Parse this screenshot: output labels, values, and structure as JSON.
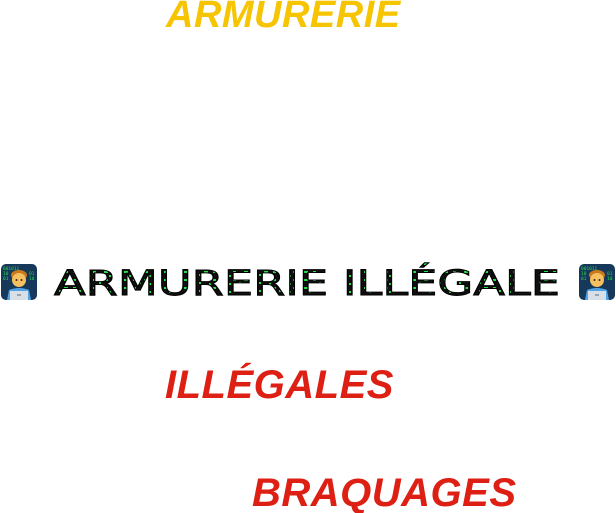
{
  "headings": {
    "top": "ARMURERIE",
    "banner": "ARMURERIE ILLÉGALE",
    "middle": "ILLÉGALES",
    "bottom": "BRAQUAGES"
  },
  "icons": {
    "banner_left": "technologist-emoji-icon",
    "banner_right": "technologist-emoji-icon"
  },
  "colors": {
    "yellow": "#f6c400",
    "red": "#dd1f14",
    "banner_text": "#101010",
    "banner_code": "#22e04a"
  }
}
